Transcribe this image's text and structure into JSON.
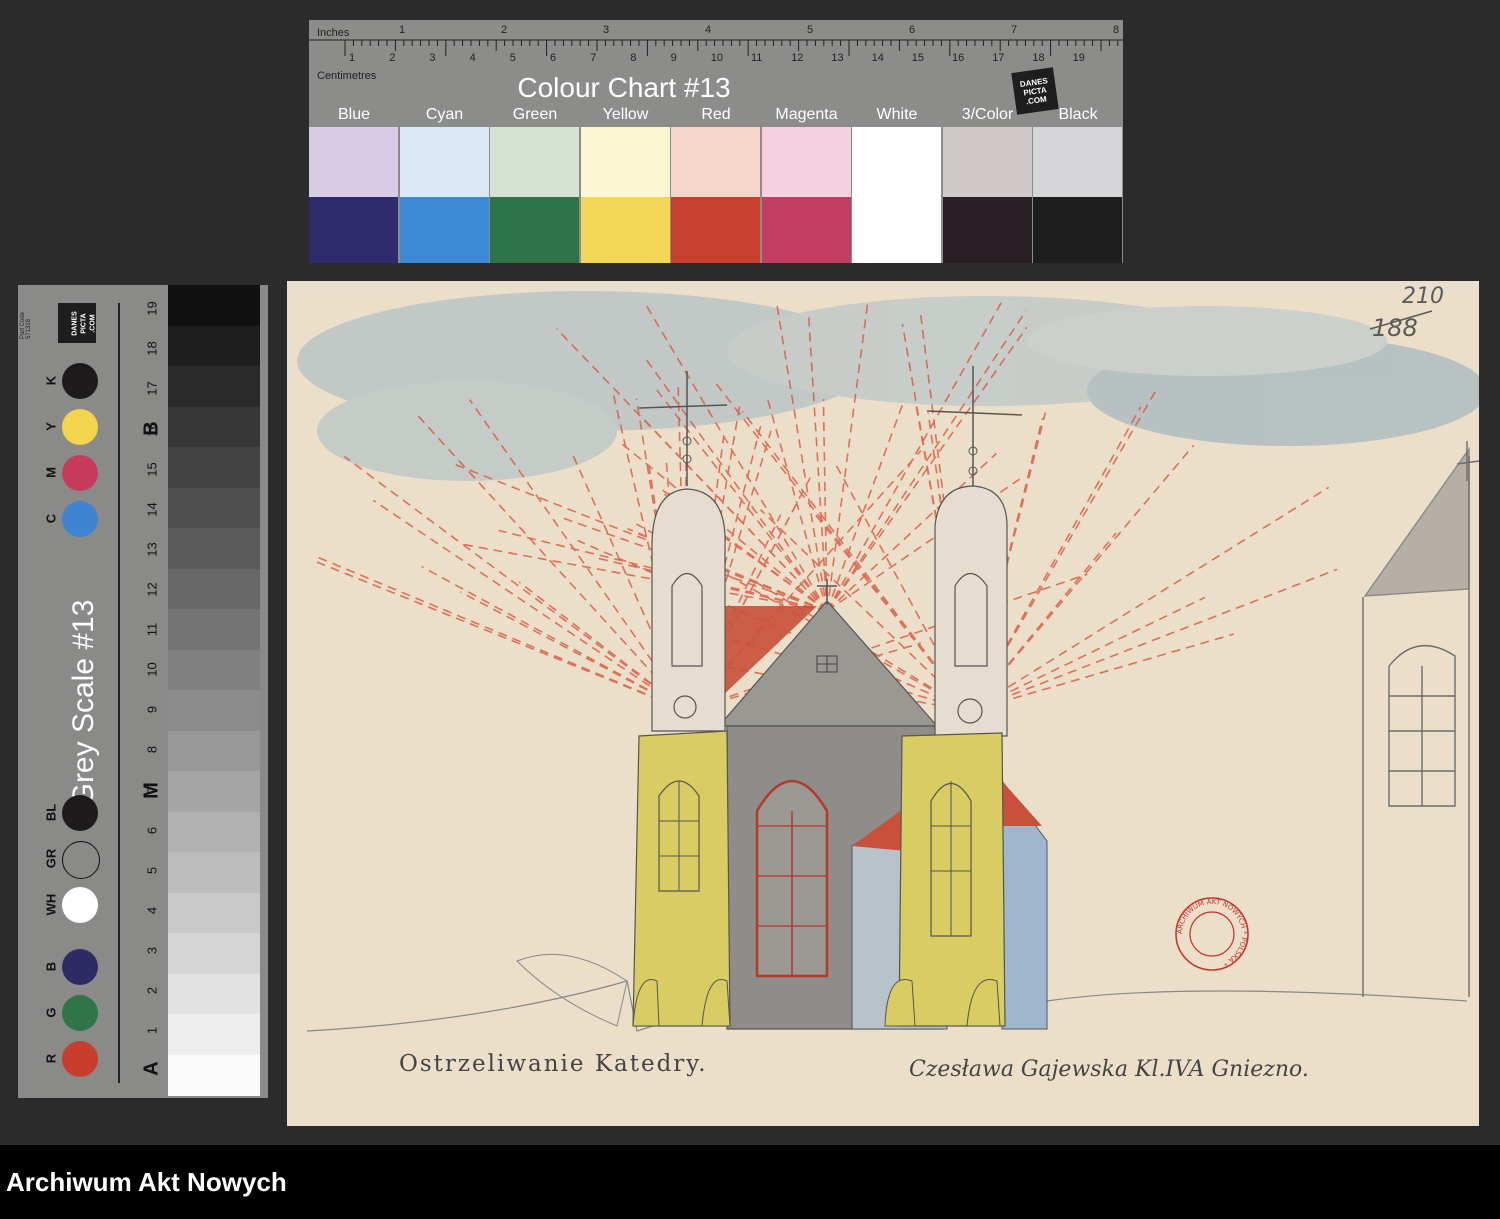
{
  "colour_chart": {
    "title": "Colour Chart #13",
    "inches_label": "Inches",
    "centimetres_label": "Centimetres",
    "inch_numbers": [
      "1",
      "2",
      "3",
      "4",
      "5",
      "6",
      "7",
      "8"
    ],
    "cm_numbers": [
      "1",
      "2",
      "3",
      "4",
      "5",
      "6",
      "7",
      "8",
      "9",
      "10",
      "11",
      "12",
      "13",
      "14",
      "15",
      "16",
      "17",
      "18",
      "19"
    ],
    "logo_text": "DANES PICTA .COM",
    "colors": [
      {
        "name": "Blue",
        "light": "#d8cce6",
        "dark": "#2e2a6b"
      },
      {
        "name": "Cyan",
        "light": "#dbe8f8",
        "dark": "#3c8ad6"
      },
      {
        "name": "Green",
        "light": "#d6e2d4",
        "dark": "#2e7448"
      },
      {
        "name": "Yellow",
        "light": "#fcf6d4",
        "dark": "#f3d757"
      },
      {
        "name": "Red",
        "light": "#f6d6c8",
        "dark": "#c8412f"
      },
      {
        "name": "Magenta",
        "light": "#f4d0de",
        "dark": "#c13d62"
      },
      {
        "name": "White",
        "light": "#ffffff",
        "dark": "#ffffff"
      },
      {
        "name": "3/Color",
        "light": "#d0c8c8",
        "dark": "#2a1f24"
      },
      {
        "name": "Black",
        "light": "#d6d6d8",
        "dark": "#1e1e1e"
      }
    ]
  },
  "grey_scale": {
    "title": "Grey Scale #13",
    "logo_text": "DANES PICTA .COM",
    "part_code": "Part Code 571318",
    "dots": [
      {
        "label": "K",
        "color": "#1c1a1a"
      },
      {
        "label": "Y",
        "color": "#f2d54a"
      },
      {
        "label": "M",
        "color": "#c83a5c"
      },
      {
        "label": "C",
        "color": "#3d85d0"
      },
      {
        "label": "BL",
        "color": "#1c1a1a"
      },
      {
        "label": "GR",
        "color": "#8a8a88"
      },
      {
        "label": "WH",
        "color": "#ffffff"
      },
      {
        "label": "B",
        "color": "#2d2a66"
      },
      {
        "label": "G",
        "color": "#2f7548"
      },
      {
        "label": "R",
        "color": "#c83c2b"
      }
    ],
    "step_numbers": [
      "1",
      "2",
      "3",
      "4",
      "5",
      "6",
      "7",
      "8",
      "9",
      "10",
      "11",
      "12",
      "13",
      "14",
      "15",
      "16",
      "17",
      "18",
      "19"
    ],
    "letters": [
      "A",
      "M",
      "B"
    ]
  },
  "drawing": {
    "caption_left": "Ostrzeliwanie Katedry.",
    "caption_right": "Czesława Gajewska Kl.IVA Gniezno.",
    "page_number_top": "210",
    "page_number_crossed": "188",
    "stamp_text": "ARCHIWUM AKT NOWYCH * POLSKA *"
  },
  "footer": {
    "label": "Archiwum Akt Nowych"
  }
}
